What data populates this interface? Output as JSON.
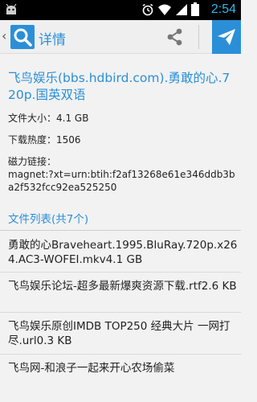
{
  "status_bar": {
    "time": "2:54",
    "icons": [
      "android-icon",
      "alarm-icon",
      "wifi-icon",
      "signal-icon",
      "battery-icon"
    ]
  },
  "action_bar": {
    "back_glyph": "‹",
    "title": "详情",
    "icons": [
      "search-icon",
      "share-icon",
      "send-icon"
    ],
    "accent": "#2b8fd8"
  },
  "detail": {
    "title": "飞鸟娱乐(bbs.hdbird.com).勇敢的心.720p.国英双语",
    "size_label": "文件大小：",
    "size_value": "4.1 GB",
    "heat_label": "下载热度：",
    "heat_value": "1506",
    "magnet_label": "磁力链接：",
    "magnet_value": "magnet:?xt=urn:btih:f2af13268e61e346ddb3ba2f532fcc92ea525250"
  },
  "file_list": {
    "header": "文件列表(共7个)",
    "items": [
      {
        "text": "勇敢的心Braveheart.1995.BluRay.720p.x264.AC3-WOFEI.mkv4.1 GB"
      },
      {
        "text": "飞鸟娱乐论坛-超多最新爆爽资源下载.rtf2.6 KB"
      },
      {
        "text": "飞鸟娱乐原创IMDB TOP250 经典大片 一网打尽.url0.3 KB"
      },
      {
        "text": "飞鸟网-和浪子一起来开心农场偷菜"
      }
    ]
  }
}
